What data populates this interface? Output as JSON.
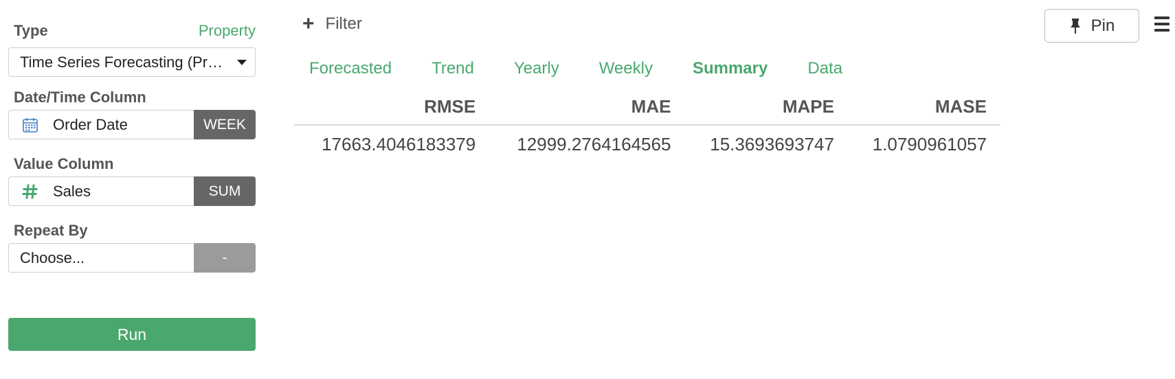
{
  "left_panel": {
    "type": {
      "label": "Type",
      "property_link": "Property",
      "selected_value": "Time Series Forecasting (Prophet)"
    },
    "date_time_column": {
      "label": "Date/Time Column",
      "value": "Order Date",
      "aggregation": "WEEK",
      "icon": "calendar-icon"
    },
    "value_column": {
      "label": "Value Column",
      "value": "Sales",
      "aggregation": "SUM",
      "icon": "hash-icon"
    },
    "repeat_by": {
      "label": "Repeat By",
      "placeholder": "Choose...",
      "aggregation": "-"
    },
    "run_label": "Run"
  },
  "toolbar": {
    "filter_label": "Filter",
    "pin_label": "Pin"
  },
  "tabs": [
    {
      "label": "Forecasted",
      "active": false
    },
    {
      "label": "Trend",
      "active": false
    },
    {
      "label": "Yearly",
      "active": false
    },
    {
      "label": "Weekly",
      "active": false
    },
    {
      "label": "Summary",
      "active": true
    },
    {
      "label": "Data",
      "active": false
    }
  ],
  "summary_table": {
    "headers": [
      "RMSE",
      "MAE",
      "MAPE",
      "MASE"
    ],
    "rows": [
      [
        "17663.4046183379",
        "12999.2764164565",
        "15.3693693747",
        "1.0790961057"
      ]
    ]
  },
  "colors": {
    "accent_green": "#4aa86e",
    "aggregation_dark": "#666666",
    "aggregation_disabled": "#9b9b9b",
    "calendar_blue": "#3f7fc4"
  }
}
